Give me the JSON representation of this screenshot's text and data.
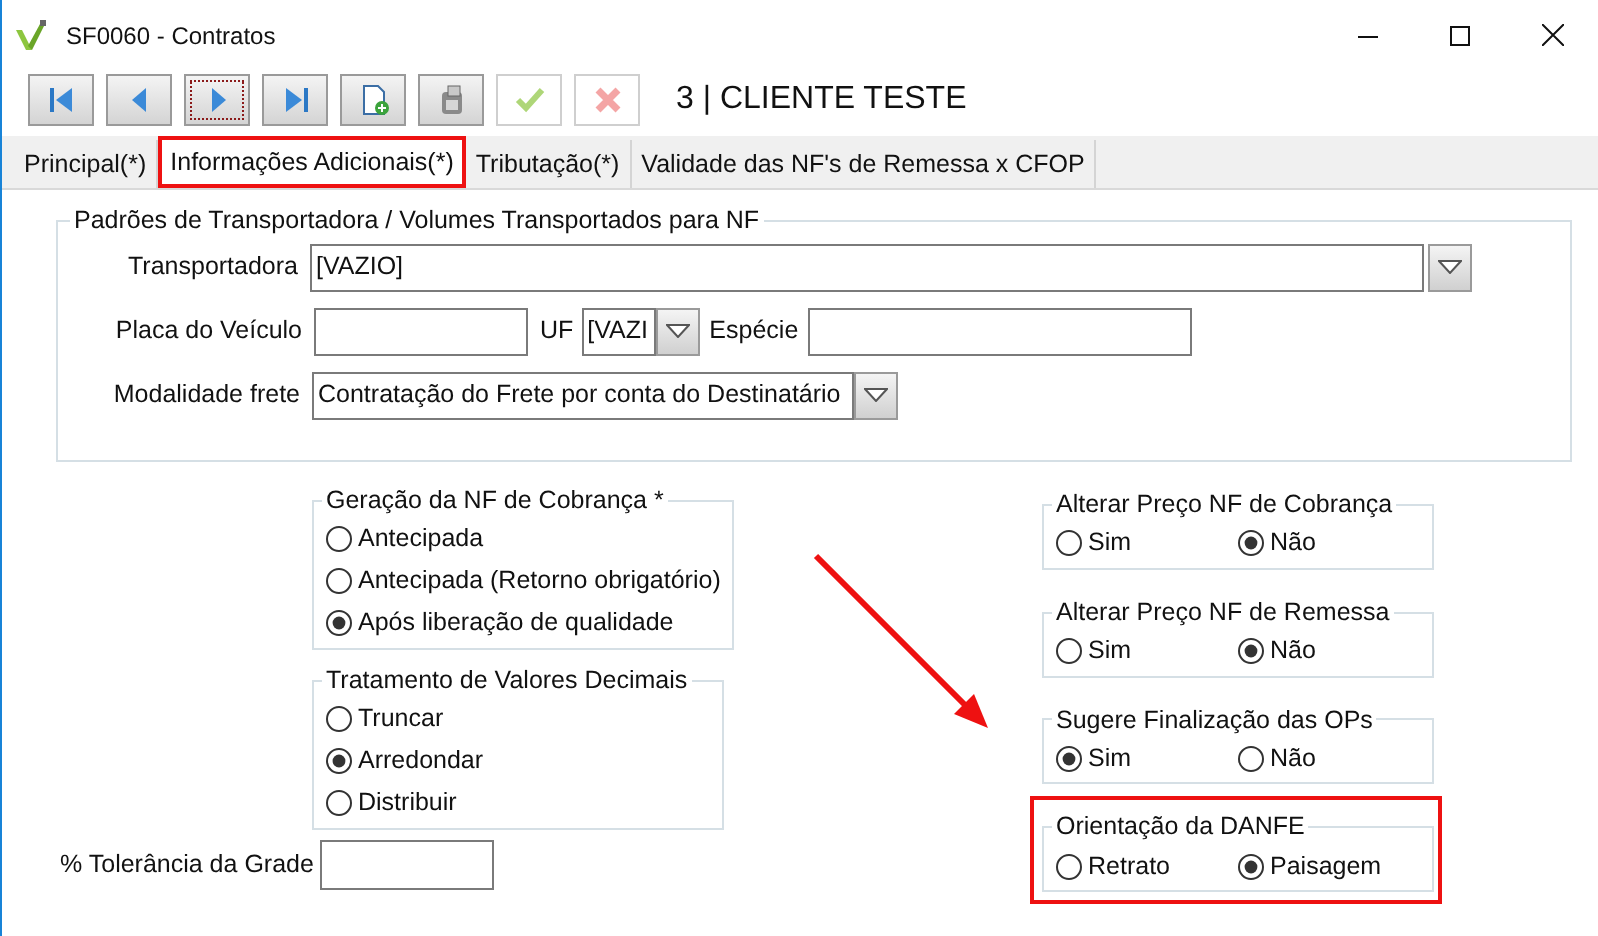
{
  "window": {
    "title": "SF0060 - Contratos"
  },
  "toolbar": {
    "buttons": [
      {
        "kind": "first",
        "disabled": false,
        "focused": false
      },
      {
        "kind": "prev",
        "disabled": false,
        "focused": false
      },
      {
        "kind": "next",
        "disabled": false,
        "focused": true
      },
      {
        "kind": "last",
        "disabled": false,
        "focused": false
      },
      {
        "kind": "new",
        "disabled": false,
        "focused": false
      },
      {
        "kind": "device",
        "disabled": false,
        "focused": false
      },
      {
        "kind": "confirm",
        "disabled": true,
        "focused": false
      },
      {
        "kind": "cancel",
        "disabled": true,
        "focused": false
      }
    ],
    "record": "3 | CLIENTE TESTE"
  },
  "tabs": [
    {
      "label": "Principal(*)",
      "selected": false,
      "highlighted": false
    },
    {
      "label": "Informações Adicionais(*)",
      "selected": true,
      "highlighted": true
    },
    {
      "label": "Tributação(*)",
      "selected": false,
      "highlighted": false
    },
    {
      "label": "Validade das NF's de Remessa x CFOP",
      "selected": false,
      "highlighted": false
    }
  ],
  "transport_group": {
    "title": "Padrões de Transportadora / Volumes Transportados para NF",
    "transportadora": {
      "label": "Transportadora",
      "value": "[VAZIO]"
    },
    "placa": {
      "label": "Placa do Veículo"
    },
    "uf": {
      "label": "UF",
      "value": "[VAZI"
    },
    "especie": {
      "label": "Espécie"
    },
    "modalidade": {
      "label": "Modalidade frete",
      "value": "Contratação do Frete por conta do Destinatário"
    }
  },
  "left_groups": [
    {
      "title": "Geração da NF de Cobrança *",
      "options": [
        {
          "label": "Antecipada",
          "selected": false
        },
        {
          "label": "Antecipada (Retorno obrigatório)",
          "selected": false
        },
        {
          "label": "Após liberação de qualidade",
          "selected": true
        }
      ]
    },
    {
      "title": "Tratamento de Valores Decimais",
      "options": [
        {
          "label": "Truncar",
          "selected": false
        },
        {
          "label": "Arredondar",
          "selected": true
        },
        {
          "label": "Distribuir",
          "selected": false
        }
      ]
    }
  ],
  "right_groups": [
    {
      "title": "Alterar Preço NF de Cobrança",
      "highlighted": false,
      "options": [
        {
          "label": "Sim",
          "selected": false
        },
        {
          "label": "Não",
          "selected": true
        }
      ]
    },
    {
      "title": "Alterar Preço NF de Remessa",
      "highlighted": false,
      "options": [
        {
          "label": "Sim",
          "selected": false
        },
        {
          "label": "Não",
          "selected": true
        }
      ]
    },
    {
      "title": "Sugere Finalização das OPs",
      "highlighted": false,
      "options": [
        {
          "label": "Sim",
          "selected": true
        },
        {
          "label": "Não",
          "selected": false
        }
      ]
    },
    {
      "title": "Orientação da DANFE",
      "highlighted": true,
      "options": [
        {
          "label": "Retrato",
          "selected": false
        },
        {
          "label": "Paisagem",
          "selected": true
        }
      ]
    }
  ],
  "tolerancia": {
    "label": "% Tolerância da Grade"
  },
  "annotation_arrow": true
}
